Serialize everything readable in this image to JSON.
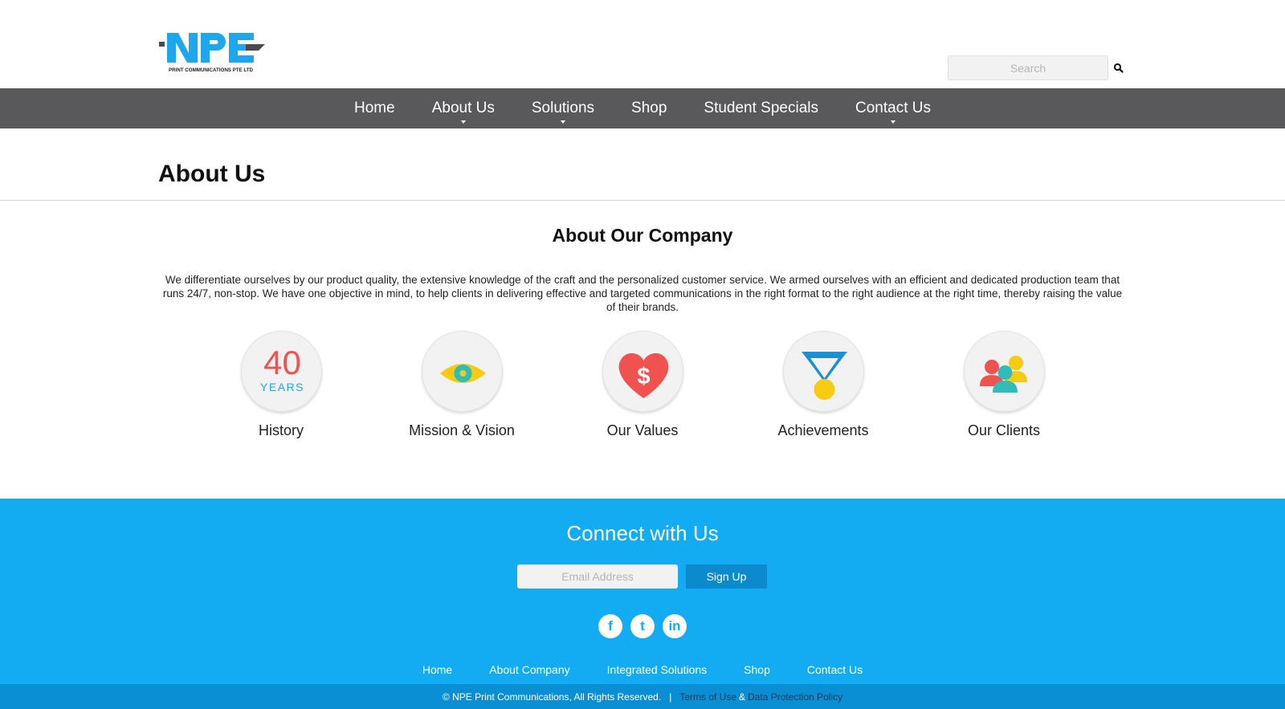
{
  "logo": {
    "text": "NPE",
    "tagline": "PRINT COMMUNICATIONS PTE LTD"
  },
  "search": {
    "placeholder": "Search",
    "icon": "search-icon"
  },
  "nav": {
    "items": [
      {
        "label": "Home",
        "has_dropdown": false
      },
      {
        "label": "About Us",
        "has_dropdown": true
      },
      {
        "label": "Solutions",
        "has_dropdown": true
      },
      {
        "label": "Shop",
        "has_dropdown": false
      },
      {
        "label": "Student Specials",
        "has_dropdown": false
      },
      {
        "label": "Contact Us",
        "has_dropdown": true
      }
    ]
  },
  "page": {
    "title": "About Us"
  },
  "about": {
    "heading": "About Our Company",
    "text": "We differentiate ourselves by our product quality, the extensive knowledge of the craft and the personalized customer service. We armed ourselves with an efficient and dedicated production team that runs 24/7, non-stop. We have one objective in mind, to help clients in delivering effective and targeted communications in the right format to the right audience at the right time, thereby raising the value of their brands."
  },
  "features": {
    "history": {
      "label": "History",
      "number": "40",
      "unit": "YEARS"
    },
    "mission": {
      "label": "Mission & Vision",
      "icon": "eye-icon"
    },
    "values": {
      "label": "Our Values",
      "icon": "heart-dollar-icon",
      "symbol": "$"
    },
    "achievements": {
      "label": "Achievements",
      "icon": "medal-icon"
    },
    "clients": {
      "label": "Our Clients",
      "icon": "people-icon"
    }
  },
  "footer": {
    "connect_title": "Connect with Us",
    "email_placeholder": "Email Address",
    "signup_label": "Sign Up",
    "socials": [
      {
        "name": "facebook",
        "glyph": "f"
      },
      {
        "name": "twitter",
        "glyph": "t"
      },
      {
        "name": "linkedin",
        "glyph": "in"
      }
    ],
    "links": [
      "Home",
      "About Company",
      "Integrated Solutions",
      "Shop",
      "Contact Us"
    ],
    "copyright": "© NPE Print Communications, All Rights Reserved.",
    "separator": "|",
    "terms": "Terms of Use",
    "amp": "&",
    "privacy": "Data Protection Policy"
  },
  "colors": {
    "brand_blue": "#13abf2",
    "nav_gray": "#59595b",
    "footer_dark_blue": "#0b8fd4",
    "signup_blue": "#0b8bce",
    "history_red": "#f0524f",
    "history_blue": "#21a8e8"
  }
}
